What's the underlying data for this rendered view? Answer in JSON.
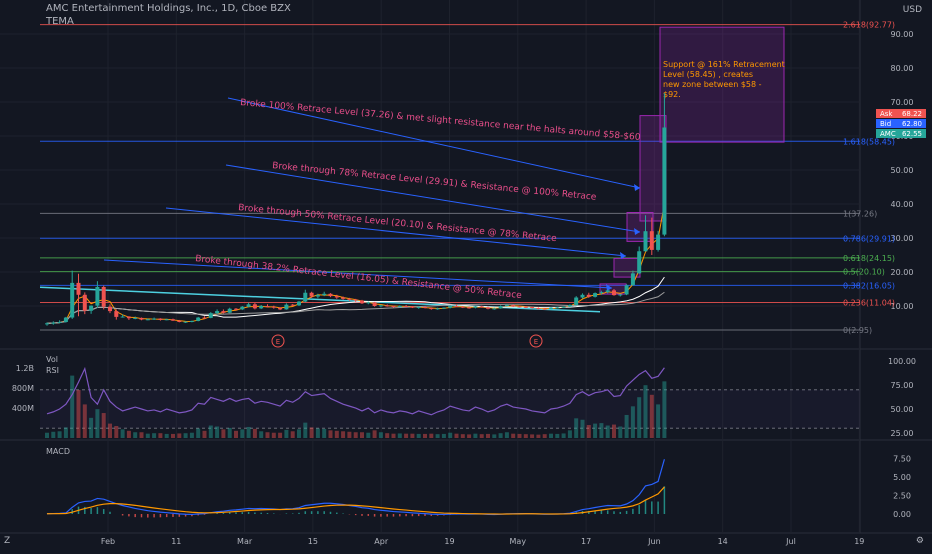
{
  "header": {
    "symbol_title": "AMC Entertainment Holdings, Inc., 1D, Cboe BZX",
    "indicator": "TEMA",
    "currency": "USD",
    "zoom_icon": "auto-scale-icon"
  },
  "colors": {
    "background": "#131722",
    "grid": "#1e222d",
    "up": "#26a69a",
    "down": "#ef5350",
    "fib_line": "#2962ff",
    "annotation": "#e84e8a",
    "note_box": "#9c27b0",
    "macd": "#2962ff",
    "signal": "#ff9800",
    "rsi": "#7e57c2"
  },
  "chart_data": [
    {
      "type": "candlestick",
      "title": "AMC Entertainment Holdings, Inc., 1D, Cboe BZX",
      "x_ticks": [
        "Feb",
        "11",
        "Mar",
        "15",
        "Apr",
        "19",
        "May",
        "17",
        "Jun",
        "14",
        "Jul",
        "19"
      ],
      "y_ticks": [
        10,
        20,
        30,
        40,
        50,
        60,
        70,
        80,
        90
      ],
      "ylim": [
        0,
        97
      ],
      "fib_levels": [
        {
          "label": "2.618(92.77)",
          "value": 92.77,
          "color": "#ef5350"
        },
        {
          "label": "1.618(58.45)",
          "value": 58.45,
          "color": "#2962ff"
        },
        {
          "label": "1(37.26)",
          "value": 37.26,
          "color": "#787b86"
        },
        {
          "label": "0.786(29.91)",
          "value": 29.91,
          "color": "#2962ff"
        },
        {
          "label": "0.618(24.15)",
          "value": 24.15,
          "color": "#4caf50"
        },
        {
          "label": "0.5(20.10)",
          "value": 20.1,
          "color": "#4caf50"
        },
        {
          "label": "0.382(16.05)",
          "value": 16.05,
          "color": "#2962ff"
        },
        {
          "label": "0.236(11.04)",
          "value": 11.04,
          "color": "#ef5350"
        },
        {
          "label": "0(2.95)",
          "value": 2.95,
          "color": "#787b86"
        }
      ],
      "price_tags": [
        {
          "name": "Ask",
          "value": "68.22",
          "color": "#ef5350"
        },
        {
          "name": "Bid",
          "value": "62.80",
          "color": "#2962ff"
        },
        {
          "name": "AMC",
          "value": "62.55",
          "color": "#26a69a"
        }
      ],
      "annotations": [
        "Broke 100% Retrace Level (37.26) & met slight resistance near the halts around $58-$60",
        "Broke through 78% Retrace Level (29.91) & Resistance @ 100% Retrace",
        "Broke through 50% Retrace Level (20.10) & Resistance @ 78% Retrace",
        "Broke through 38.2% Retrace Level (16.05) & Resistance @ 50% Retrace"
      ],
      "note": "Support @ 161% Retracement Level (58.45) , creates new zone between $58 - $92.",
      "earnings_marker": "E",
      "candles": [
        [
          4.6,
          5.2,
          4.2,
          4.9
        ],
        [
          4.9,
          5.5,
          4.5,
          5.1
        ],
        [
          5.1,
          5.8,
          4.9,
          5.3
        ],
        [
          5.3,
          6.8,
          5.1,
          6.6
        ],
        [
          6.6,
          20.4,
          6.2,
          16.8
        ],
        [
          16.8,
          19.5,
          7.0,
          13.3
        ],
        [
          13.3,
          14.0,
          7.6,
          8.6
        ],
        [
          8.6,
          10.2,
          7.7,
          10.1
        ],
        [
          10.1,
          17.3,
          9.4,
          15.6
        ],
        [
          15.6,
          16.0,
          9.0,
          9.8
        ],
        [
          9.8,
          10.5,
          7.9,
          8.5
        ],
        [
          8.5,
          9.0,
          6.0,
          6.8
        ],
        [
          6.8,
          7.5,
          6.6,
          6.9
        ],
        [
          6.9,
          7.0,
          5.9,
          6.4
        ],
        [
          6.4,
          6.9,
          6.1,
          6.5
        ],
        [
          6.5,
          6.6,
          5.8,
          6.0
        ],
        [
          6.0,
          6.3,
          5.8,
          6.1
        ],
        [
          6.1,
          6.6,
          5.9,
          6.3
        ],
        [
          6.3,
          6.4,
          5.7,
          5.9
        ],
        [
          5.9,
          6.2,
          5.8,
          6.1
        ],
        [
          6.1,
          6.3,
          5.6,
          5.7
        ],
        [
          5.7,
          5.9,
          5.2,
          5.3
        ],
        [
          5.3,
          5.5,
          5.0,
          5.4
        ],
        [
          5.4,
          5.7,
          5.2,
          5.6
        ],
        [
          5.6,
          6.8,
          5.5,
          6.6
        ],
        [
          6.6,
          7.0,
          6.3,
          6.5
        ],
        [
          6.5,
          8.2,
          6.4,
          7.9
        ],
        [
          7.9,
          9.0,
          7.6,
          8.5
        ],
        [
          8.5,
          9.0,
          7.8,
          8.0
        ],
        [
          8.0,
          9.5,
          7.9,
          9.2
        ],
        [
          9.2,
          9.4,
          8.7,
          9.0
        ],
        [
          9.0,
          10.0,
          8.8,
          9.8
        ],
        [
          9.8,
          11.0,
          9.6,
          10.5
        ],
        [
          10.5,
          10.9,
          9.0,
          9.3
        ],
        [
          9.3,
          10.3,
          9.1,
          10.0
        ],
        [
          10.0,
          10.5,
          9.6,
          9.8
        ],
        [
          9.8,
          10.1,
          9.2,
          9.5
        ],
        [
          9.5,
          9.6,
          8.8,
          9.0
        ],
        [
          9.0,
          10.8,
          8.9,
          10.4
        ],
        [
          10.4,
          10.6,
          9.9,
          10.2
        ],
        [
          10.2,
          11.5,
          10.0,
          11.3
        ],
        [
          11.3,
          14.8,
          11.1,
          13.9
        ],
        [
          13.9,
          14.2,
          12.4,
          12.8
        ],
        [
          12.8,
          13.6,
          12.3,
          13.2
        ],
        [
          13.2,
          14.2,
          12.9,
          13.6
        ],
        [
          13.6,
          13.8,
          12.6,
          12.9
        ],
        [
          12.9,
          13.3,
          12.1,
          12.5
        ],
        [
          12.5,
          12.8,
          11.8,
          12.1
        ],
        [
          12.1,
          12.4,
          11.5,
          11.9
        ],
        [
          11.9,
          12.1,
          11.2,
          11.6
        ],
        [
          11.6,
          11.8,
          10.6,
          10.8
        ],
        [
          10.8,
          11.3,
          10.5,
          11.1
        ],
        [
          11.1,
          11.2,
          9.8,
          10.0
        ],
        [
          10.0,
          10.4,
          9.6,
          10.2
        ],
        [
          10.2,
          10.5,
          9.8,
          10.0
        ],
        [
          10.0,
          10.1,
          9.5,
          9.8
        ],
        [
          9.8,
          10.2,
          9.6,
          10.0
        ],
        [
          10.0,
          10.3,
          9.7,
          9.9
        ],
        [
          9.9,
          10.0,
          9.4,
          9.5
        ],
        [
          9.5,
          9.8,
          9.2,
          9.7
        ],
        [
          9.7,
          9.9,
          9.3,
          9.4
        ],
        [
          9.4,
          9.6,
          8.9,
          9.1
        ],
        [
          9.1,
          9.5,
          8.9,
          9.3
        ],
        [
          9.3,
          9.6,
          9.1,
          9.5
        ],
        [
          9.5,
          10.2,
          9.3,
          10.0
        ],
        [
          10.0,
          10.4,
          9.7,
          9.8
        ],
        [
          9.8,
          10.0,
          9.4,
          9.6
        ],
        [
          9.6,
          9.9,
          9.2,
          9.5
        ],
        [
          9.5,
          10.0,
          9.3,
          9.9
        ],
        [
          9.9,
          10.1,
          9.5,
          9.6
        ],
        [
          9.6,
          9.8,
          9.0,
          9.2
        ],
        [
          9.2,
          9.5,
          8.9,
          9.3
        ],
        [
          9.3,
          10.2,
          9.2,
          10.0
        ],
        [
          10.0,
          10.5,
          9.8,
          10.3
        ],
        [
          10.3,
          10.4,
          9.7,
          9.9
        ],
        [
          9.9,
          10.1,
          9.6,
          9.8
        ],
        [
          9.8,
          10.0,
          9.4,
          9.7
        ],
        [
          9.7,
          9.8,
          9.2,
          9.4
        ],
        [
          9.4,
          9.6,
          9.0,
          9.2
        ],
        [
          9.2,
          9.4,
          8.9,
          9.1
        ],
        [
          9.1,
          9.7,
          9.0,
          9.5
        ],
        [
          9.5,
          9.8,
          9.3,
          9.6
        ],
        [
          9.6,
          9.9,
          9.4,
          9.8
        ],
        [
          9.8,
          10.5,
          9.7,
          10.3
        ],
        [
          10.3,
          12.9,
          10.2,
          12.5
        ],
        [
          12.5,
          13.7,
          12.2,
          13.3
        ],
        [
          13.3,
          13.9,
          12.4,
          12.7
        ],
        [
          12.7,
          14.0,
          12.5,
          13.8
        ],
        [
          13.8,
          14.5,
          13.3,
          14.1
        ],
        [
          14.1,
          14.8,
          13.7,
          14.6
        ],
        [
          14.6,
          15.0,
          13.0,
          13.2
        ],
        [
          13.2,
          13.6,
          12.8,
          13.4
        ],
        [
          13.4,
          16.4,
          13.2,
          16.1
        ],
        [
          16.1,
          20.4,
          16.0,
          19.6
        ],
        [
          19.6,
          27.5,
          19.5,
          26.1
        ],
        [
          26.1,
          36.7,
          26.0,
          32.0
        ],
        [
          32.0,
          36.0,
          25.0,
          26.5
        ],
        [
          26.5,
          32.1,
          26.0,
          31.0
        ],
        [
          31.0,
          72.6,
          30.5,
          62.5
        ]
      ]
    },
    {
      "type": "bar",
      "title": "Vol",
      "volume_ticks": [
        "1.2B",
        "800M",
        "400M"
      ],
      "rsi_label": "RSI",
      "rsi_ticks": [
        100.0,
        75.0,
        50.0,
        25.0
      ],
      "rsi_levels": [
        70,
        30
      ],
      "rsi": [
        45,
        47,
        50,
        55,
        65,
        78,
        92,
        62,
        55,
        70,
        58,
        52,
        48,
        50,
        52,
        50,
        48,
        49,
        47,
        50,
        48,
        46,
        47,
        49,
        56,
        55,
        62,
        60,
        58,
        61,
        58,
        60,
        61,
        56,
        58,
        57,
        55,
        53,
        59,
        57,
        61,
        68,
        64,
        65,
        66,
        61,
        58,
        55,
        53,
        51,
        48,
        51,
        46,
        49,
        47,
        46,
        48,
        47,
        45,
        48,
        46,
        44,
        47,
        49,
        53,
        51,
        49,
        48,
        52,
        50,
        47,
        49,
        53,
        55,
        52,
        51,
        50,
        48,
        47,
        46,
        50,
        51,
        53,
        56,
        65,
        68,
        64,
        67,
        68,
        70,
        63,
        64,
        74,
        80,
        86,
        90,
        82,
        84,
        93
      ],
      "volume": [
        110,
        130,
        140,
        220,
        1300,
        1000,
        700,
        420,
        600,
        520,
        300,
        250,
        180,
        150,
        120,
        120,
        90,
        100,
        100,
        85,
        85,
        95,
        100,
        110,
        200,
        150,
        260,
        240,
        180,
        210,
        150,
        180,
        230,
        190,
        140,
        120,
        110,
        110,
        170,
        140,
        180,
        320,
        220,
        200,
        190,
        160,
        150,
        140,
        130,
        120,
        120,
        110,
        160,
        120,
        100,
        90,
        95,
        90,
        90,
        85,
        85,
        90,
        80,
        85,
        110,
        90,
        80,
        75,
        90,
        80,
        85,
        75,
        100,
        120,
        90,
        85,
        80,
        75,
        70,
        80,
        90,
        85,
        95,
        160,
        410,
        380,
        270,
        300,
        310,
        260,
        280,
        240,
        480,
        660,
        850,
        1100,
        900,
        700,
        1180
      ]
    },
    {
      "type": "line",
      "title": "MACD",
      "y_ticks": [
        7.5,
        5.0,
        2.5,
        0.0
      ],
      "macd": [
        0.05,
        0.06,
        0.08,
        0.15,
        0.9,
        1.5,
        1.7,
        1.75,
        2.1,
        2.0,
        1.7,
        1.4,
        1.15,
        0.95,
        0.75,
        0.6,
        0.45,
        0.35,
        0.25,
        0.18,
        0.1,
        0.02,
        -0.03,
        -0.06,
        0.0,
        0.05,
        0.18,
        0.3,
        0.38,
        0.5,
        0.56,
        0.65,
        0.75,
        0.72,
        0.74,
        0.72,
        0.68,
        0.6,
        0.7,
        0.72,
        0.85,
        1.15,
        1.25,
        1.35,
        1.45,
        1.45,
        1.38,
        1.28,
        1.15,
        1.02,
        0.85,
        0.78,
        0.6,
        0.5,
        0.42,
        0.33,
        0.28,
        0.23,
        0.15,
        0.1,
        0.05,
        -0.02,
        -0.05,
        -0.06,
        -0.02,
        0.0,
        0.0,
        -0.02,
        0.0,
        -0.01,
        -0.05,
        -0.07,
        -0.03,
        0.02,
        0.04,
        0.05,
        0.05,
        0.03,
        0.0,
        -0.03,
        -0.02,
        0.0,
        0.03,
        0.1,
        0.35,
        0.6,
        0.72,
        0.88,
        1.02,
        1.15,
        1.12,
        1.1,
        1.35,
        1.8,
        2.6,
        3.8,
        4.0,
        4.4,
        7.4
      ],
      "signal": [
        0.03,
        0.04,
        0.05,
        0.07,
        0.24,
        0.5,
        0.74,
        0.94,
        1.17,
        1.33,
        1.4,
        1.4,
        1.35,
        1.27,
        1.17,
        1.05,
        0.93,
        0.81,
        0.7,
        0.6,
        0.5,
        0.4,
        0.31,
        0.24,
        0.19,
        0.16,
        0.17,
        0.19,
        0.23,
        0.28,
        0.34,
        0.4,
        0.47,
        0.52,
        0.56,
        0.59,
        0.61,
        0.61,
        0.63,
        0.65,
        0.69,
        0.78,
        0.87,
        0.97,
        1.07,
        1.15,
        1.19,
        1.21,
        1.2,
        1.17,
        1.1,
        1.04,
        0.95,
        0.86,
        0.77,
        0.68,
        0.6,
        0.53,
        0.45,
        0.38,
        0.31,
        0.24,
        0.18,
        0.13,
        0.1,
        0.08,
        0.06,
        0.04,
        0.03,
        0.02,
        0.01,
        0.0,
        -0.01,
        0.0,
        0.01,
        0.02,
        0.03,
        0.03,
        0.02,
        0.01,
        0.0,
        0.0,
        0.01,
        0.03,
        0.09,
        0.19,
        0.3,
        0.42,
        0.54,
        0.66,
        0.75,
        0.82,
        0.93,
        1.1,
        1.4,
        1.88,
        2.3,
        2.72,
        3.66
      ]
    }
  ],
  "footer": {
    "left": "Z",
    "right": "⚙"
  }
}
